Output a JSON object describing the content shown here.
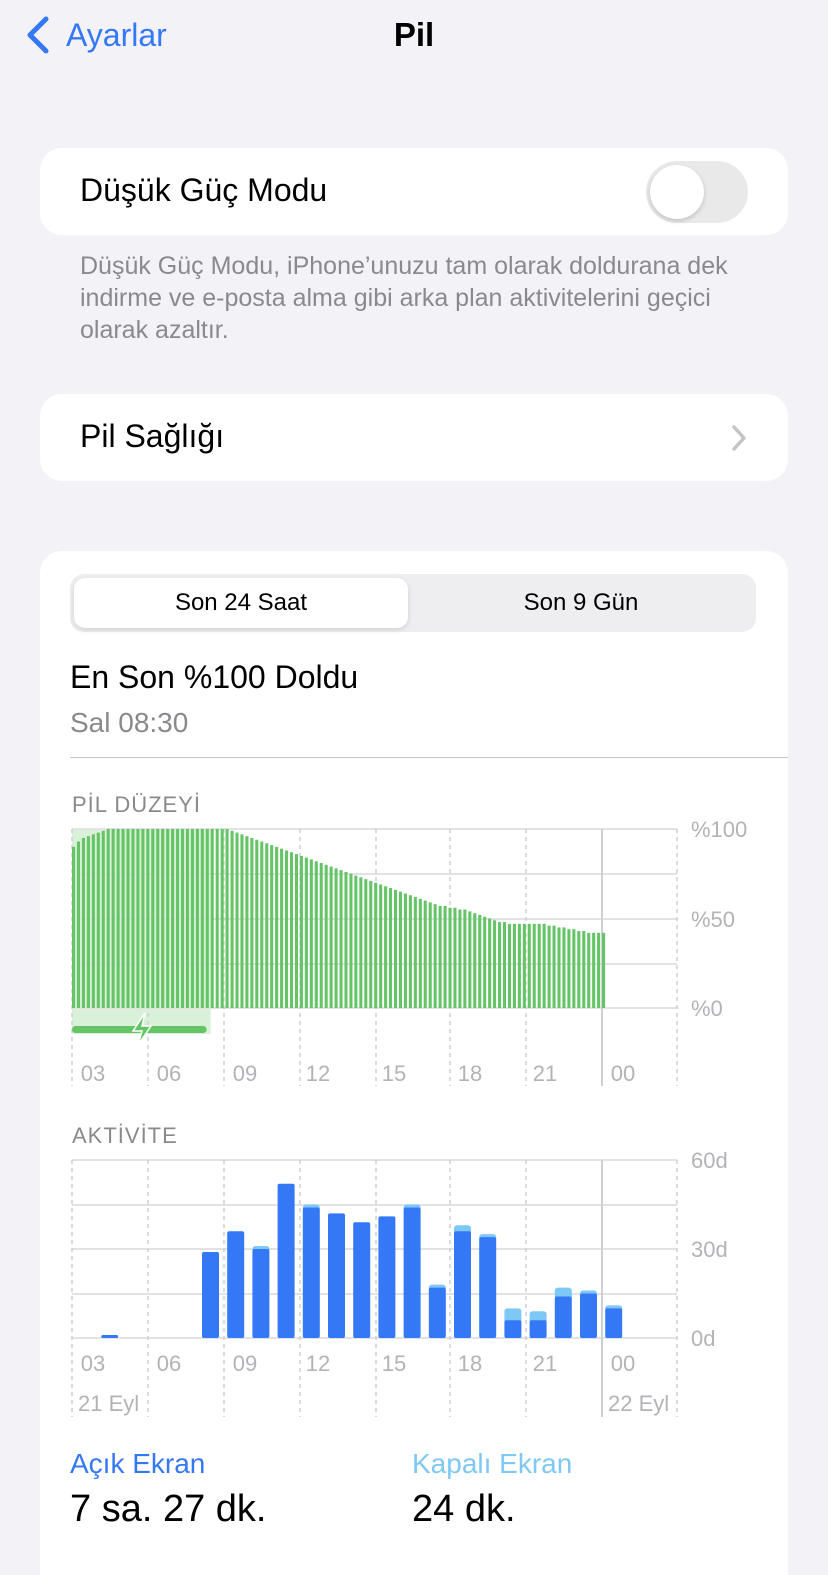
{
  "nav": {
    "back_label": "Ayarlar",
    "title": "Pil"
  },
  "low_power": {
    "label": "Düşük Güç Modu",
    "enabled": false,
    "footnote": "Düşük Güç Modu, iPhone’unuzu tam olarak doldurana dek indirme ve e-posta alma gibi arka plan aktivitelerini geçici olarak azaltır."
  },
  "battery_health": {
    "label": "Pil Sağlığı"
  },
  "usage": {
    "segments": [
      "Son 24 Saat",
      "Son 9 Gün"
    ],
    "selected_segment": "Son 24 Saat",
    "last_charge_title": "En Son %100 Doldu",
    "last_charge_time": "Sal 08:30",
    "battery_section_label": "PİL DÜZEYİ",
    "activity_section_label": "AKTİVİTE",
    "screen_on": {
      "label": "Açık Ekran",
      "value": "7 sa. 27 dk."
    },
    "screen_off": {
      "label": "Kapalı Ekran",
      "value": "24 dk."
    }
  },
  "colors": {
    "accent": "#3478f6",
    "battery_green": "#64c466",
    "charging_band": "#d9f0d9",
    "screen_on_bar": "#3478f6",
    "screen_off_bar": "#7ec8f5",
    "secondary_text": "#8a8a8e"
  },
  "chart_data": [
    {
      "type": "bar",
      "name": "battery_level",
      "title": "PİL DÜZEYİ",
      "x_tick_labels": [
        "03",
        "06",
        "09",
        "12",
        "15",
        "18",
        "21",
        "00"
      ],
      "y_tick_labels": [
        "%100",
        "%50",
        "%0"
      ],
      "ylim": [
        0,
        100
      ],
      "grid": true,
      "charging_interval_hours": [
        2.0,
        7.5
      ],
      "charging_icon": "bolt-icon",
      "values": [
        90,
        93,
        95,
        96,
        97,
        98,
        99,
        100,
        100,
        100,
        100,
        100,
        100,
        100,
        100,
        100,
        100,
        100,
        100,
        100,
        100,
        100,
        100,
        100,
        100,
        100,
        100,
        100,
        100,
        100,
        100,
        100,
        99,
        98,
        97,
        96,
        95,
        94,
        93,
        92,
        91,
        90,
        89,
        88,
        87,
        86,
        85,
        84,
        83,
        82,
        81,
        80,
        79,
        78,
        77,
        76,
        75,
        74,
        73,
        72,
        71,
        70,
        69,
        68,
        67,
        66,
        65,
        64,
        63,
        62,
        61,
        60,
        59,
        58,
        57,
        57,
        56,
        56,
        55,
        55,
        54,
        53,
        52,
        51,
        50,
        49,
        48,
        48,
        47,
        47,
        47,
        47,
        47,
        47,
        47,
        47,
        46,
        46,
        45,
        45,
        44,
        44,
        43,
        43,
        42,
        42,
        42,
        42
      ]
    },
    {
      "type": "bar",
      "name": "activity",
      "title": "AKTİVİTE",
      "categories": [
        "02",
        "03",
        "04",
        "05",
        "06",
        "07",
        "08",
        "09",
        "10",
        "11",
        "12",
        "13",
        "14",
        "15",
        "16",
        "17",
        "18",
        "19",
        "20",
        "21",
        "22",
        "23"
      ],
      "x_tick_labels": [
        "03",
        "06",
        "09",
        "12",
        "15",
        "18",
        "21",
        "00"
      ],
      "date_labels": [
        "21 Eyl",
        "22 Eyl"
      ],
      "y_tick_labels": [
        "60d",
        "30d",
        "0d"
      ],
      "ylim": [
        0,
        60
      ],
      "unit": "minutes",
      "grid": true,
      "series": [
        {
          "name": "Açık Ekran",
          "values": [
            0,
            1,
            0,
            0,
            0,
            29,
            36,
            30,
            52,
            44,
            42,
            39,
            41,
            44,
            17,
            36,
            34,
            6,
            6,
            14,
            15,
            10
          ]
        },
        {
          "name": "Kapalı Ekran",
          "values": [
            0,
            0,
            0,
            0,
            0,
            0,
            0,
            1,
            0,
            1,
            0,
            0,
            0,
            1,
            1,
            2,
            1,
            4,
            3,
            3,
            1,
            1
          ]
        }
      ]
    }
  ]
}
